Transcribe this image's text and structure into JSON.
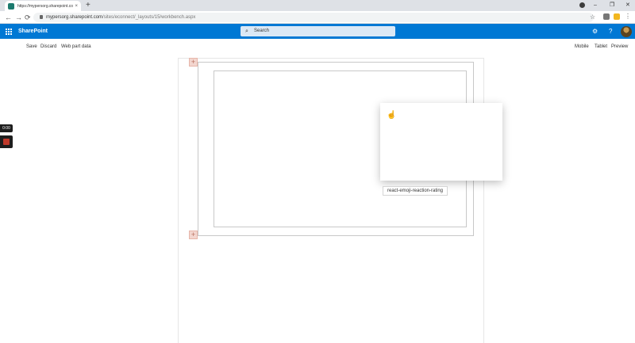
{
  "browser": {
    "tab_title": "https://mypersorg.sharepoint.co",
    "tab_close": "×",
    "new_tab": "+",
    "url_host": "mypersorg.sharepoint.com",
    "url_path": "/sites/econnect/_layouts/15/workbench.aspx",
    "back": "←",
    "forward": "→",
    "reload": "⟳",
    "star": "☆",
    "minimize": "–",
    "maximize": "❐",
    "close": "✕"
  },
  "suitebar": {
    "brand": "SharePoint",
    "search_placeholder": "Search",
    "search_icon": "⌕",
    "settings_icon": "⚙",
    "help_icon": "?"
  },
  "commands": {
    "save": "Save",
    "discard": "Discard",
    "web_part_data": "Web part data",
    "mobile": "Mobile",
    "tablet": "Tablet",
    "preview": "Preview"
  },
  "canvas": {
    "add_section_top": "+",
    "add_section_bottom": "+",
    "tooltip": "react-emoji-reaction-rating"
  },
  "recorder": {
    "time": "0:00"
  },
  "colors": {
    "suite_blue": "#0078d4",
    "add_button": "#f3d6cf"
  }
}
